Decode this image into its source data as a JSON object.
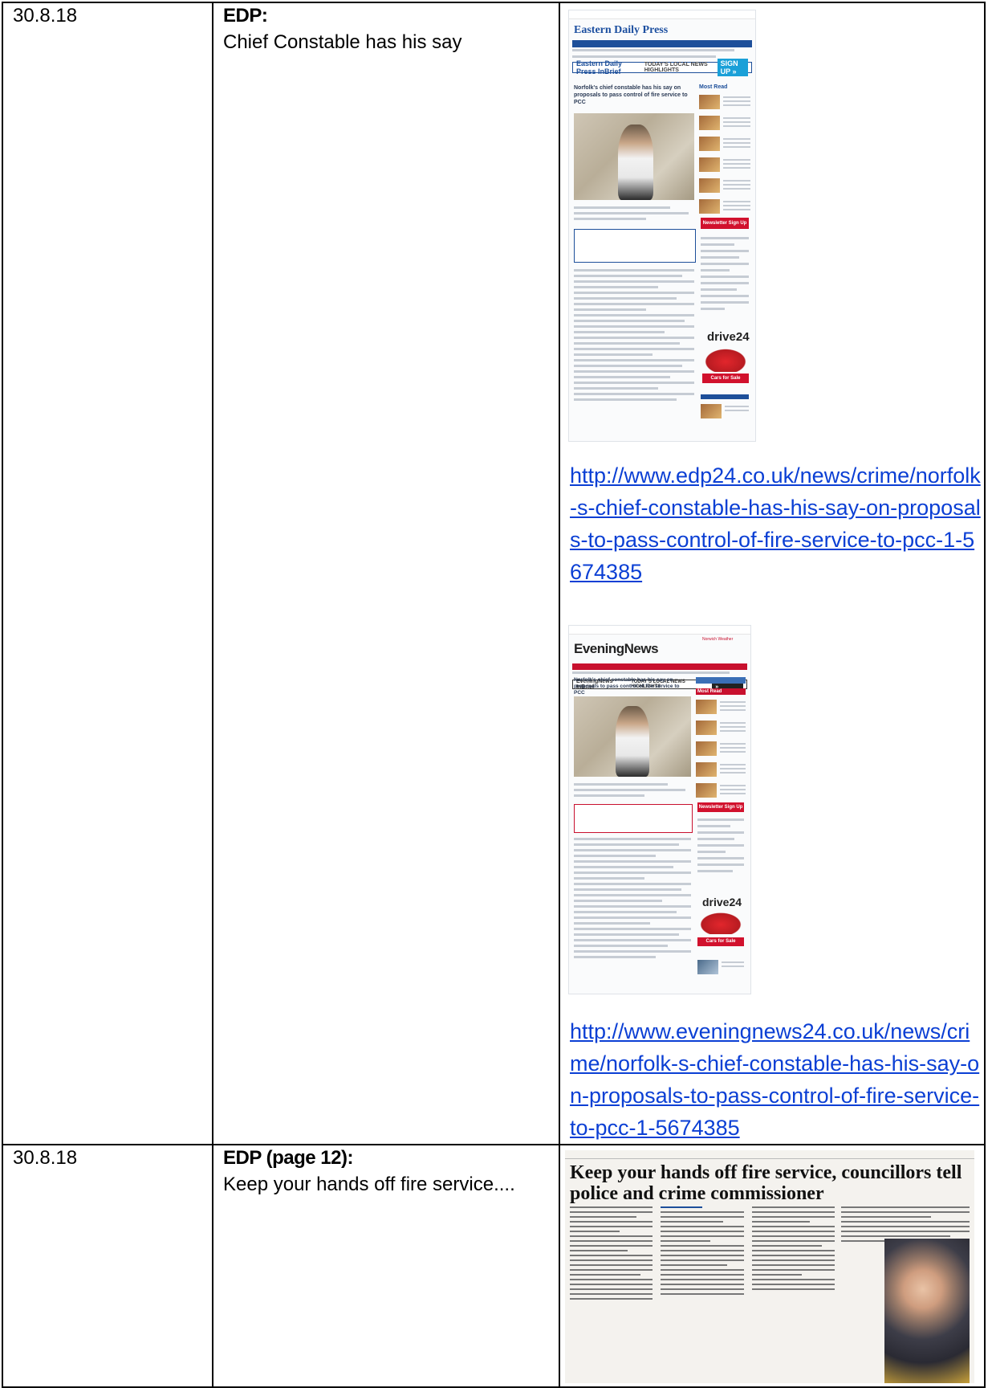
{
  "rows": [
    {
      "date": "30.8.18",
      "publication": "EDP:",
      "headline": "Chief Constable has his say",
      "items": [
        {
          "screenshot": {
            "masthead": "Eastern Daily Press",
            "brief": "Eastern Daily Press InBrief",
            "brief_mid": "TODAY'S LOCAL NEWS HIGHLIGHTS",
            "brief_btn": "SIGN UP »",
            "article_title": "Norfolk's chief constable has his say on proposals to pass control of fire service to PCC",
            "sidebar_title": "Most Read",
            "newsletter": "Newsletter Sign Up",
            "ad_brand": "drive24",
            "ad_btn": "Cars for Sale"
          },
          "url": "http://www.edp24.co.uk/news/crime/norfolk-s-chief-constable-has-his-say-on-proposals-to-pass-control-of-fire-service-to-pcc-1-5674385"
        },
        {
          "screenshot": {
            "masthead": "EveningNews",
            "weather": "Norwich Weather",
            "brief": "EveningNews InBrief",
            "brief_mid": "TODAY'S LOCAL NEWS HIGHLIGHTS",
            "brief_btn": "SIGN UP »",
            "article_title": "Norfolk's chief constable has his say on proposals to pass control of fire service to PCC",
            "sidebar_title": "Most Read",
            "newsletter": "Newsletter Sign Up",
            "ad_brand": "drive24",
            "ad_btn": "Cars for Sale"
          },
          "url": "http://www.eveningnews24.co.uk/news/crime/norfolk-s-chief-constable-has-his-say-on-proposals-to-pass-control-of-fire-service-to-pcc-1-5674385"
        }
      ]
    },
    {
      "date": "30.8.18",
      "publication": "EDP (page 12):",
      "headline": "Keep your hands off fire service....",
      "clipping_headline": "Keep your hands off fire service, councillors tell police and crime commissioner"
    }
  ]
}
